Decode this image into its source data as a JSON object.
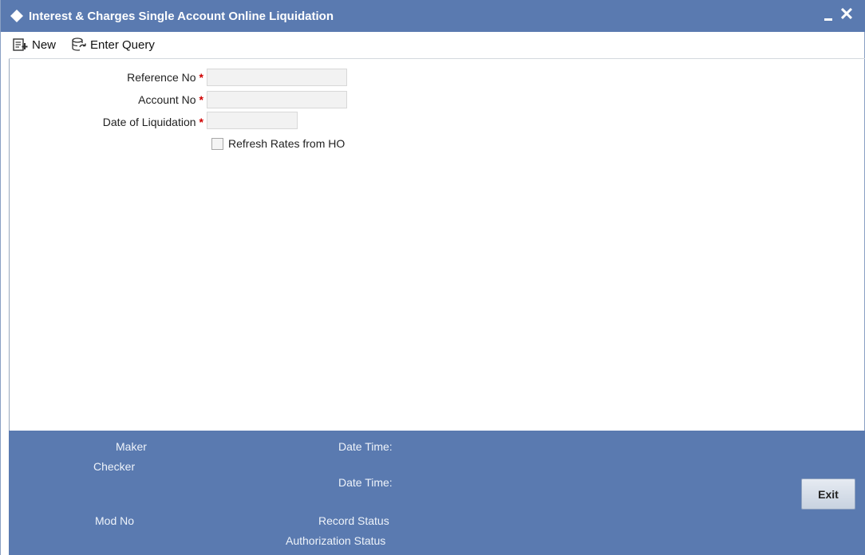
{
  "window": {
    "title": "Interest & Charges Single Account Online Liquidation",
    "close_glyph": "✕"
  },
  "toolbar": {
    "new_label": "New",
    "enter_query_label": "Enter Query"
  },
  "form": {
    "reference_no_label": "Reference No",
    "account_no_label": "Account No",
    "date_of_liquidation_label": "Date of Liquidation",
    "required_marker": "*",
    "reference_no_value": "",
    "account_no_value": "",
    "date_of_liquidation_value": "",
    "refresh_rates_label": "Refresh Rates from HO",
    "refresh_rates_checked": false
  },
  "footer": {
    "maker_label": "Maker",
    "checker_label": "Checker",
    "mod_no_label": "Mod No",
    "date_time_label_1": "Date Time:",
    "date_time_label_2": "Date Time:",
    "record_status_label": "Record Status",
    "authorization_status_label": "Authorization Status",
    "exit_label": "Exit"
  },
  "colors": {
    "titlebar_bg": "#5a7ab0",
    "footer_bg": "#5a7ab0",
    "required": "#d00000"
  },
  "icons": {
    "title": "diamond-icon",
    "new": "new-document-icon",
    "enter_query": "query-icon",
    "minimize": "minimize-icon",
    "close": "close-icon"
  }
}
